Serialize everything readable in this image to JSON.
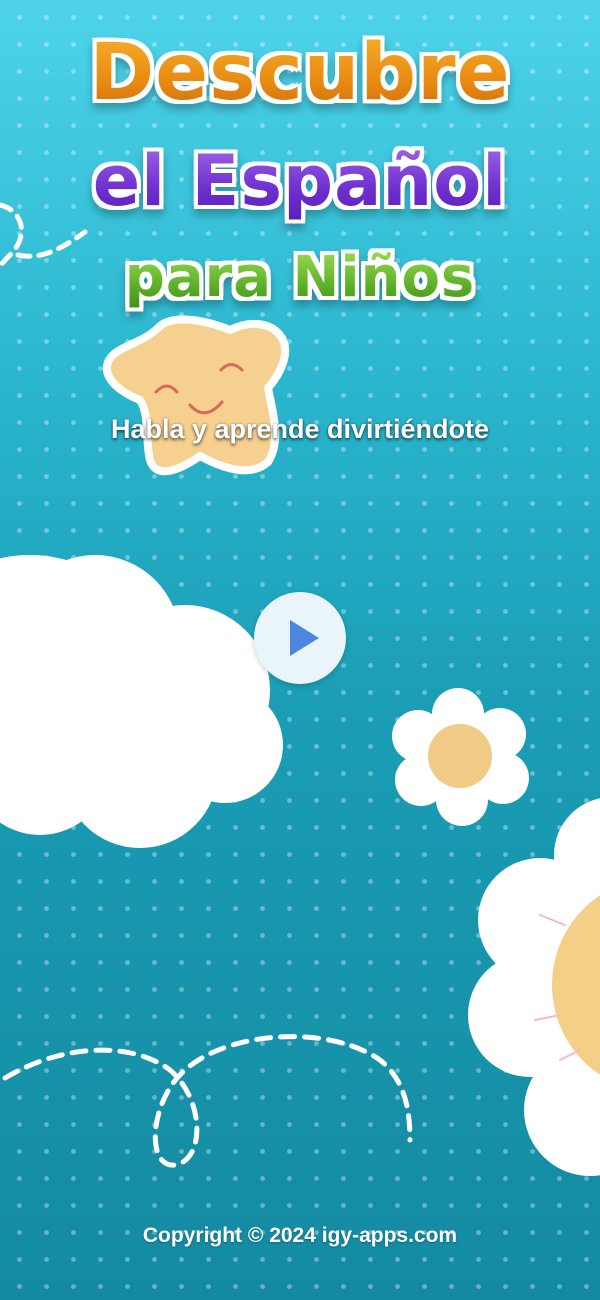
{
  "title": {
    "line1": "Descubre",
    "line2": "el Español",
    "line3": "para Niños"
  },
  "subtitle": "Habla y aprende divirtiéndote",
  "play_button": {
    "icon": "play-icon"
  },
  "footer": {
    "copyright": "Copyright © 2024 igy-apps.com"
  },
  "colors": {
    "background_top": "#4ed3ea",
    "background_bottom": "#148aa1",
    "title_orange": "#e98a12",
    "title_purple": "#6d2fcf",
    "title_green": "#5fb22a",
    "play_icon": "#4c86e0",
    "star": "#f6d08e",
    "flower_center": "#f1cb85"
  },
  "decorations": [
    "star-mascot",
    "cloud",
    "flower",
    "sun-flower",
    "dashed-trail"
  ]
}
